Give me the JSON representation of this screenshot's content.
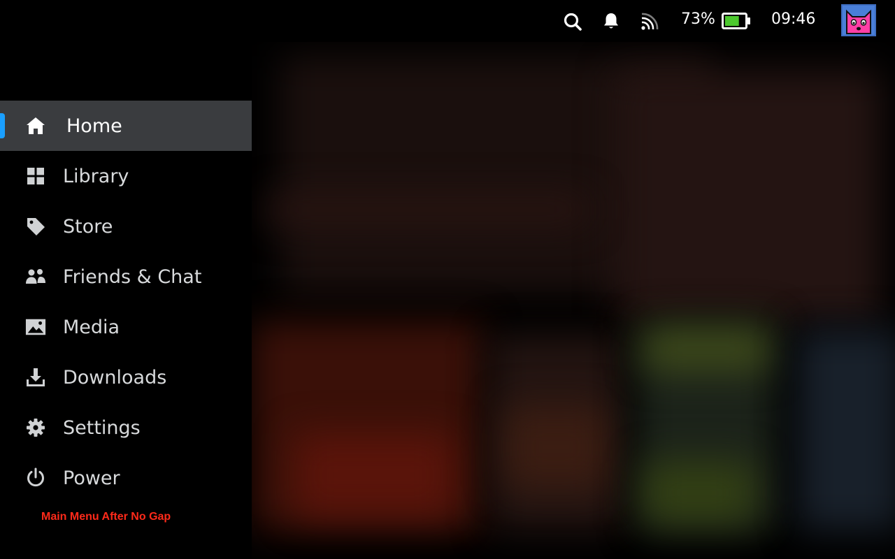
{
  "status_bar": {
    "search_icon": "search-icon",
    "notifications_icon": "bell-icon",
    "network_icon": "wifi-signal-icon",
    "battery_percent": "73%",
    "battery_level": 0.73,
    "battery_color": "#4cc82e",
    "clock": "09:46",
    "avatar_icon": "pink-cat-avatar"
  },
  "menu": {
    "accent_color": "#1a9fff",
    "items": [
      {
        "label": "Home",
        "icon": "home-icon",
        "active": true
      },
      {
        "label": "Library",
        "icon": "grid-icon",
        "active": false
      },
      {
        "label": "Store",
        "icon": "tag-icon",
        "active": false
      },
      {
        "label": "Friends & Chat",
        "icon": "people-icon",
        "active": false
      },
      {
        "label": "Media",
        "icon": "image-icon",
        "active": false
      },
      {
        "label": "Downloads",
        "icon": "download-icon",
        "active": false
      },
      {
        "label": "Settings",
        "icon": "gear-icon",
        "active": false
      },
      {
        "label": "Power",
        "icon": "power-icon",
        "active": false
      }
    ]
  },
  "debug_label": "Main Menu After No Gap"
}
